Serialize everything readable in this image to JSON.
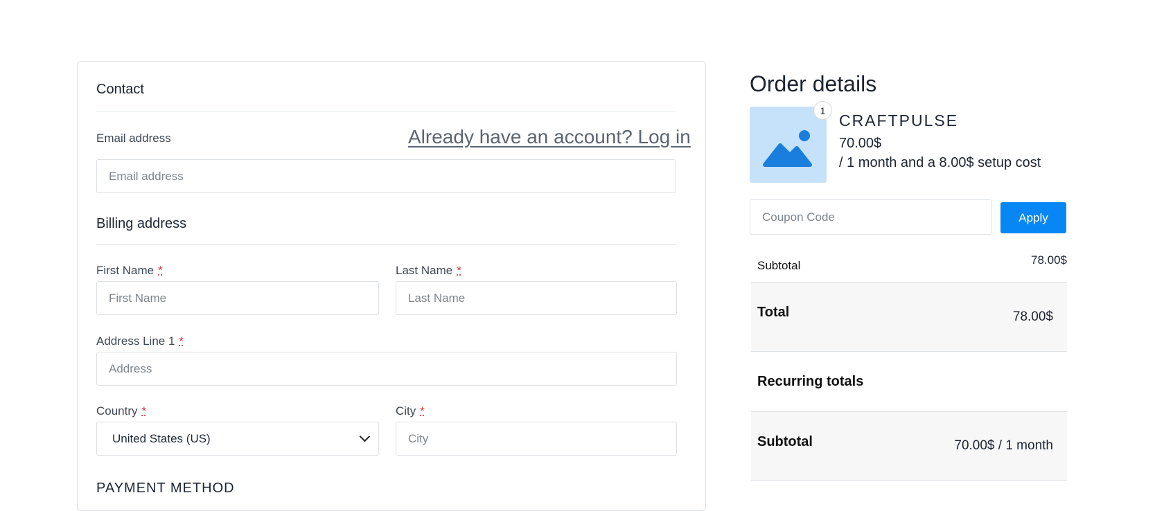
{
  "contact": {
    "title": "Contact",
    "email_label": "Email address",
    "login_link": "Already have an account? Log in",
    "email_placeholder": "Email address"
  },
  "billing": {
    "title": "Billing address",
    "first_name_label": "First Name",
    "first_name_placeholder": "First Name",
    "last_name_label": "Last Name",
    "last_name_placeholder": "Last Name",
    "address_label": "Address Line 1",
    "address_placeholder": "Address",
    "country_label": "Country",
    "country_value": "United States (US)",
    "city_label": "City",
    "city_placeholder": "City",
    "required_mark": "*"
  },
  "payment": {
    "title": "PAYMENT METHOD"
  },
  "order": {
    "title": "Order details",
    "quantity": "1",
    "product_name": "CRAFTPULSE",
    "price": "70.00$",
    "billing_cycle": "/ 1 month and a 8.00$ setup cost",
    "thumbnail_icon": "image-placeholder-icon",
    "coupon_placeholder": "Coupon Code",
    "apply_label": "Apply",
    "subtotal_label": "Subtotal",
    "subtotal_value": "78.00$",
    "total_label": "Total",
    "total_value": "78.00$",
    "recurring_title": "Recurring totals",
    "recurring_subtotal_label": "Subtotal",
    "recurring_subtotal_value": "70.00$ / 1 month"
  },
  "colors": {
    "accent": "#0787f3",
    "thumbnail_bg": "#c6e2fb",
    "required": "#d9313a"
  }
}
